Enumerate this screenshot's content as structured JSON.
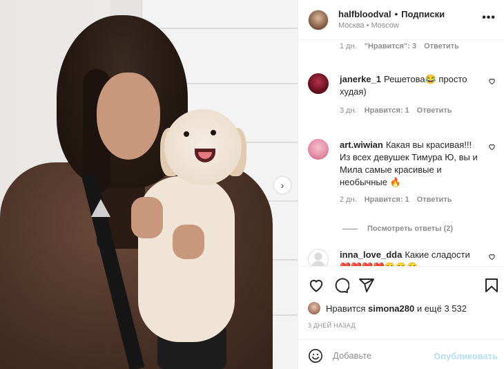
{
  "photo": {
    "alt": "Woman in fur hat holding a white dog"
  },
  "header": {
    "username": "halfbloodval",
    "dot": "•",
    "follow_status": "Подписки",
    "location": "Москва • Moscow"
  },
  "top_meta": {
    "time": "1 дн.",
    "likes": "\"Нравится\": 3",
    "reply": "Ответить"
  },
  "comments": [
    {
      "username": "janerke_1",
      "text": "Решетова😂 просто худая)",
      "time": "3 дн.",
      "likes": "Нравится: 1",
      "reply": "Ответить"
    },
    {
      "username": "art.wiwian",
      "text": "Какая вы красивая!!! Из всех девушек Тимура Ю, вы и Мила самые красивые и необычные 🔥",
      "time": "2 дн.",
      "likes": "Нравится: 1",
      "reply": "Ответить"
    },
    {
      "username": "inna_love_dda",
      "text": "Какие сладости ❤️❤️❤️❤️😋😋😋"
    }
  ],
  "view_replies": "Посмотреть ответы (2)",
  "likes_bar": {
    "prefix": "Нравится",
    "user": "simona280",
    "suffix": "и ещё 3 532"
  },
  "post_date": "3 дней назад",
  "comment_box": {
    "placeholder": "Добавьте",
    "publish_label": "Опубликовать"
  },
  "icons": {
    "like": "heart-icon",
    "comment": "comment-icon",
    "share": "share-icon",
    "save": "bookmark-icon",
    "more": "more-icon",
    "next": "chevron-right-icon",
    "emoji": "emoji-icon"
  },
  "colors": {
    "publish_disabled": "#b2dffc",
    "muted": "#8e8e8e",
    "text": "#262626"
  }
}
